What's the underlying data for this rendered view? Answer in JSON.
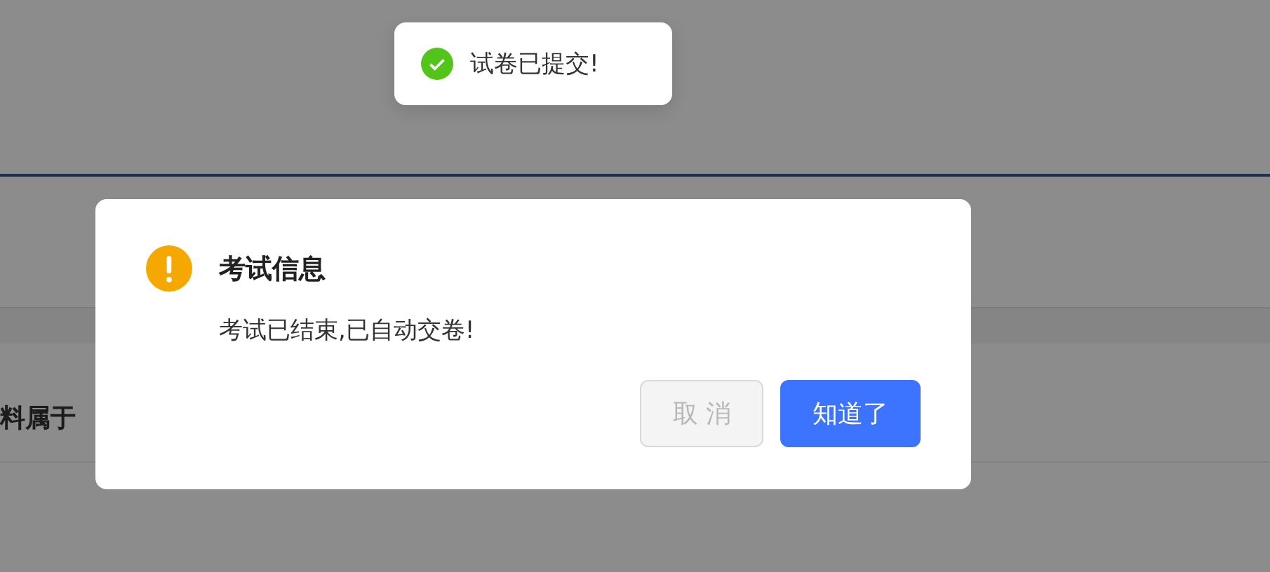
{
  "page": {
    "row_text": "料属于"
  },
  "toast": {
    "kind": "success",
    "message": "试卷已提交!"
  },
  "dialog": {
    "kind": "warning",
    "title": "考试信息",
    "message": "考试已结束,已自动交卷!",
    "buttons": [
      {
        "label": "取 消",
        "kind": "default",
        "disabled": true
      },
      {
        "label": "知道了",
        "kind": "primary",
        "disabled": false
      }
    ]
  }
}
